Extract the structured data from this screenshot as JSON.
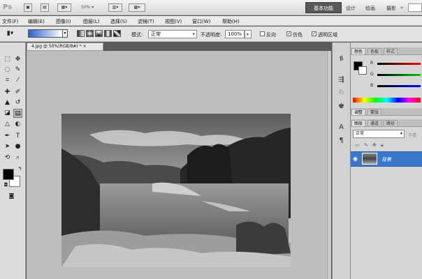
{
  "app": {
    "logo": "Ps",
    "zoom": "50%"
  },
  "workspaces": {
    "active": "基本功能",
    "items": [
      "设计",
      "绘画",
      "摄影"
    ],
    "more": "»"
  },
  "menu": [
    "文件(F)",
    "编辑(E)",
    "图像(I)",
    "图层(L)",
    "选择(S)",
    "滤镜(T)",
    "视图(V)",
    "窗口(W)",
    "帮助(H)"
  ],
  "options": {
    "mode_label": "模式:",
    "mode_value": "正常",
    "opacity_label": "不透明度:",
    "opacity_value": "100%",
    "reverse_label": "反向",
    "dither_label": "仿色",
    "transparency_label": "透明区域"
  },
  "document": {
    "tab_title": "4.jpg @ 50%(RGB/8#) *",
    "close_glyph": "×"
  },
  "panels": {
    "color_tabs": [
      "颜色",
      "色板",
      "样式"
    ],
    "adjust_tabs": [
      "调整",
      "蒙版"
    ],
    "layer_tabs": [
      "图层",
      "通道",
      "路径"
    ],
    "blend_mode": "正常",
    "opacity_short": "不透",
    "channel_r": "R",
    "channel_g": "G",
    "channel_b": "B",
    "layer_name": "背景"
  },
  "colors": {
    "accent": "#3a78c9",
    "foreground": "#000000",
    "background": "#ffffff"
  }
}
